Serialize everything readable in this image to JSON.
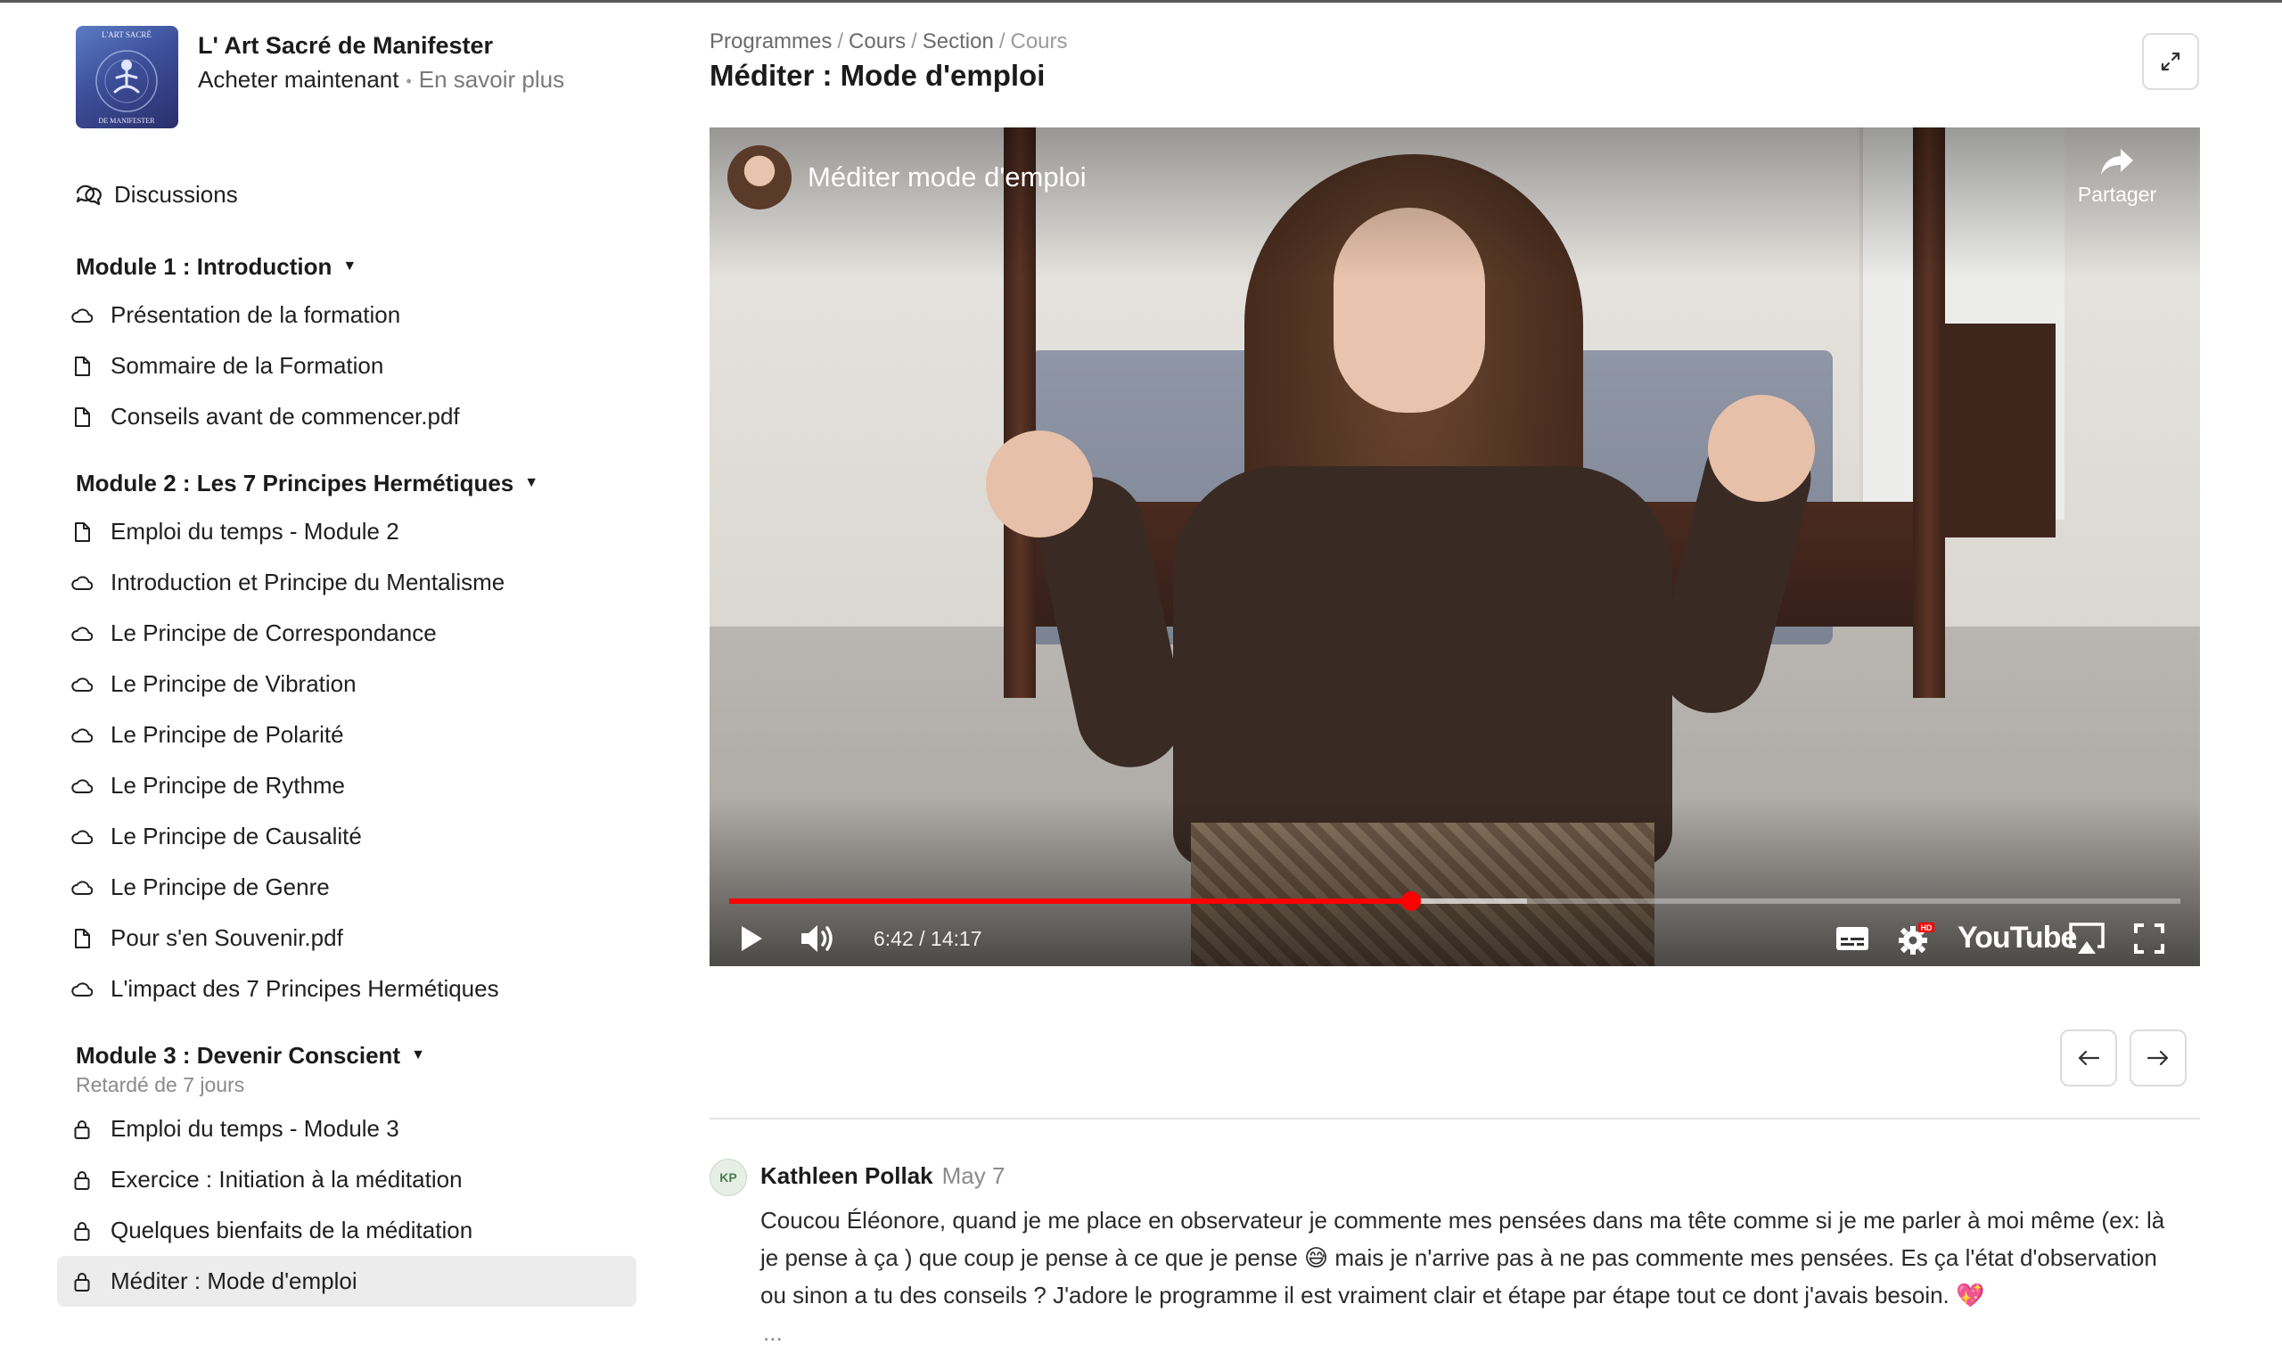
{
  "brand": {
    "title": "L' Art Sacré de Manifester",
    "buy_label": "Acheter maintenant",
    "separator": "•",
    "learn_label": "En savoir plus",
    "logo_text_top": "L'ART SACRÉ",
    "logo_text_bottom": "DE MANIFESTER"
  },
  "sidebar": {
    "discussions_label": "Discussions",
    "modules": [
      {
        "title": "Module 1 : Introduction",
        "subtitle": "",
        "items": [
          {
            "label": "Présentation de la formation",
            "icon": "cloud-icon"
          },
          {
            "label": "Sommaire de la Formation",
            "icon": "document-icon"
          },
          {
            "label": "Conseils avant de commencer.pdf",
            "icon": "document-icon"
          }
        ]
      },
      {
        "title": "Module 2 : Les 7 Principes Hermétiques",
        "subtitle": "",
        "items": [
          {
            "label": "Emploi du temps - Module 2",
            "icon": "document-icon"
          },
          {
            "label": "Introduction et Principe du Mentalisme",
            "icon": "cloud-icon"
          },
          {
            "label": "Le Principe de Correspondance",
            "icon": "cloud-icon"
          },
          {
            "label": "Le Principe de Vibration",
            "icon": "cloud-icon"
          },
          {
            "label": "Le Principe de Polarité",
            "icon": "cloud-icon"
          },
          {
            "label": "Le Principe de Rythme",
            "icon": "cloud-icon"
          },
          {
            "label": "Le Principe de Causalité",
            "icon": "cloud-icon"
          },
          {
            "label": "Le Principe de Genre",
            "icon": "cloud-icon"
          },
          {
            "label": "Pour s'en Souvenir.pdf",
            "icon": "document-icon"
          },
          {
            "label": "L'impact des 7 Principes Hermétiques",
            "icon": "cloud-icon"
          }
        ]
      },
      {
        "title": "Module 3 : Devenir Conscient",
        "subtitle": "Retardé de 7 jours",
        "items": [
          {
            "label": "Emploi du temps - Module 3",
            "icon": "lock-icon"
          },
          {
            "label": "Exercice : Initiation à la méditation",
            "icon": "lock-icon"
          },
          {
            "label": "Quelques bienfaits de la méditation",
            "icon": "lock-icon"
          },
          {
            "label": "Méditer : Mode d'emploi",
            "icon": "lock-icon",
            "active": true
          }
        ]
      }
    ]
  },
  "breadcrumb": {
    "items": [
      "Programmes",
      "Cours",
      "Section"
    ],
    "current": "Cours",
    "separator": "/"
  },
  "page_title": "Méditer : Mode d'emploi",
  "video": {
    "title": "Méditer mode d'emploi",
    "share_label": "Partager",
    "time_display": "6:42 / 14:17",
    "progress_fraction": 0.47,
    "buffer_fraction": 0.55,
    "brand_label": "YouTube",
    "accent_color": "#ff0000"
  },
  "comment": {
    "avatar_initials": "KP",
    "author": "Kathleen Pollak",
    "date": "May 7",
    "body": "Coucou Éléonore, quand je me place en observateur je commente mes pensées dans ma tête comme si je me parler à moi même (ex: là je pense à ça ) que coup je pense à ce que je pense 😅 mais je n'arrive pas à ne pas commente mes pensées. Es ça l'état d'observation ou sinon a tu des conseils ? J'adore le programme il est vraiment clair et étape par étape tout ce dont j'avais besoin. 💖",
    "more": "..."
  }
}
